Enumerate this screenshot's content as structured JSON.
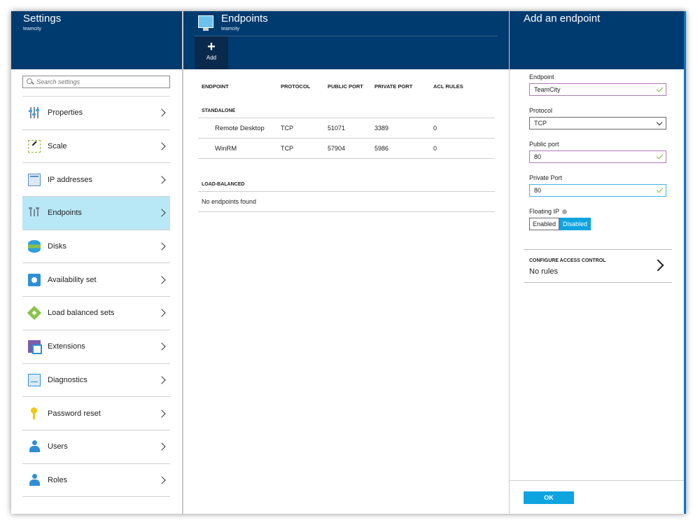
{
  "settings": {
    "title": "Settings",
    "subtitle": "teamcity",
    "search_placeholder": "Search settings",
    "items": [
      {
        "label": "Properties",
        "icon": "properties-icon"
      },
      {
        "label": "Scale",
        "icon": "scale-icon"
      },
      {
        "label": "IP addresses",
        "icon": "ip-addresses-icon"
      },
      {
        "label": "Endpoints",
        "icon": "endpoints-icon",
        "active": true
      },
      {
        "label": "Disks",
        "icon": "disks-icon"
      },
      {
        "label": "Availability set",
        "icon": "availability-set-icon"
      },
      {
        "label": "Load balanced sets",
        "icon": "load-balanced-sets-icon"
      },
      {
        "label": "Extensions",
        "icon": "extensions-icon"
      },
      {
        "label": "Diagnostics",
        "icon": "diagnostics-icon"
      },
      {
        "label": "Password reset",
        "icon": "key-icon"
      },
      {
        "label": "Users",
        "icon": "users-icon"
      },
      {
        "label": "Roles",
        "icon": "roles-icon"
      }
    ]
  },
  "endpoints": {
    "title": "Endpoints",
    "subtitle": "teamcity",
    "add_label": "Add",
    "columns": [
      "ENDPOINT",
      "PROTOCOL",
      "PUBLIC PORT",
      "PRIVATE PORT",
      "ACL RULES"
    ],
    "standalone_label": "STANDALONE",
    "rows": [
      {
        "name": "Remote Desktop",
        "protocol": "TCP",
        "public_port": "51071",
        "private_port": "3389",
        "acl": "0"
      },
      {
        "name": "WinRM",
        "protocol": "TCP",
        "public_port": "57904",
        "private_port": "5986",
        "acl": "0"
      }
    ],
    "load_balanced_label": "LOAD-BALANCED",
    "empty_text": "No endpoints found"
  },
  "add_endpoint": {
    "title": "Add an endpoint",
    "endpoint_label": "Endpoint",
    "endpoint_value": "TeamCity",
    "protocol_label": "Protocol",
    "protocol_value": "TCP",
    "public_port_label": "Public port",
    "public_port_value": "80",
    "private_port_label": "Private Port",
    "private_port_value": "80",
    "floating_ip_label": "Floating IP",
    "floating_enabled": "Enabled",
    "floating_disabled": "Disabled",
    "acl_title": "CONFIGURE ACCESS CONTROL",
    "acl_value": "No rules",
    "ok_label": "OK"
  },
  "colors": {
    "header": "#003b6f",
    "accent": "#0ea4e0",
    "active_item": "#b8e8f6"
  }
}
